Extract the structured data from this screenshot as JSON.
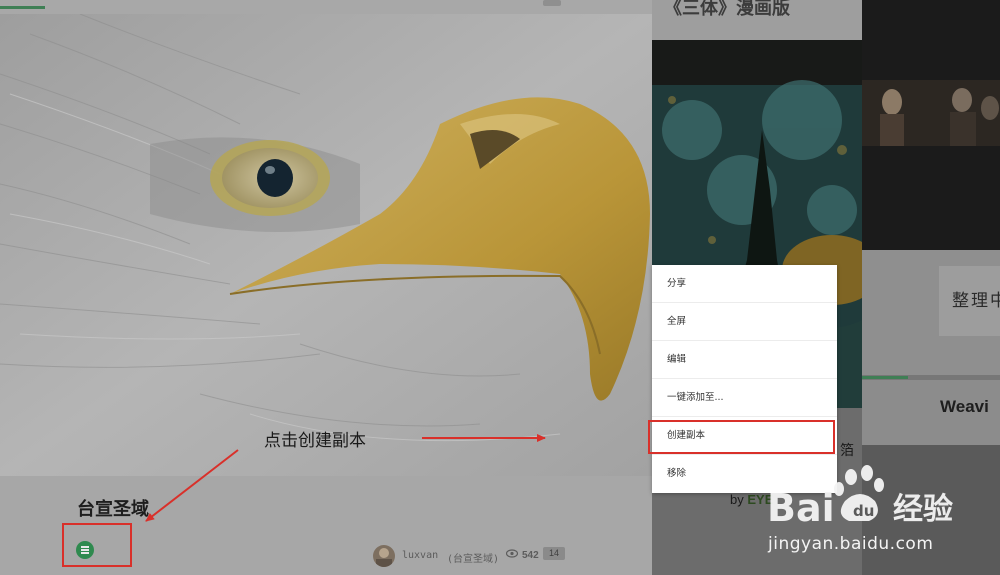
{
  "card": {
    "title": "台宣圣域",
    "author": "luxvan",
    "source": "(台宣圣域)",
    "views": "542",
    "count_badge": "14"
  },
  "annotation": {
    "text": "点击创建副本"
  },
  "context_menu": {
    "items": [
      {
        "label": "分享"
      },
      {
        "label": "全屏"
      },
      {
        "label": "编辑"
      },
      {
        "label": "一键添加至..."
      },
      {
        "label": "创建副本"
      },
      {
        "label": "移除"
      }
    ],
    "highlighted_index": 4
  },
  "card2": {
    "title": "《三体》漫画版",
    "snippet": "箔",
    "by_prefix": "by",
    "brand": "EYE"
  },
  "card3": {
    "sorting_text": "整理中",
    "title": "Weavi"
  },
  "watermark": {
    "brand": "Bai du 经验",
    "url": "jingyan.baidu.com"
  },
  "colors": {
    "accent_green": "#3f7f55",
    "annotation_red": "#d9302a"
  }
}
